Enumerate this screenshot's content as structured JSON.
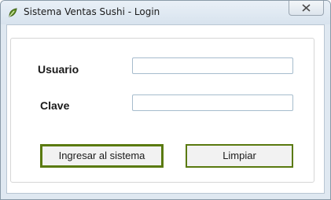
{
  "window": {
    "title": "Sistema Ventas Sushi - Login",
    "icon": "leaf-icon"
  },
  "form": {
    "usuario_label": "Usuario",
    "usuario_value": "",
    "clave_label": "Clave",
    "clave_value": ""
  },
  "buttons": {
    "login_label": "Ingresar al sistema",
    "clear_label": "Limpiar"
  },
  "colors": {
    "button_border": "#5a7a10",
    "field_border": "#a6bccd"
  }
}
